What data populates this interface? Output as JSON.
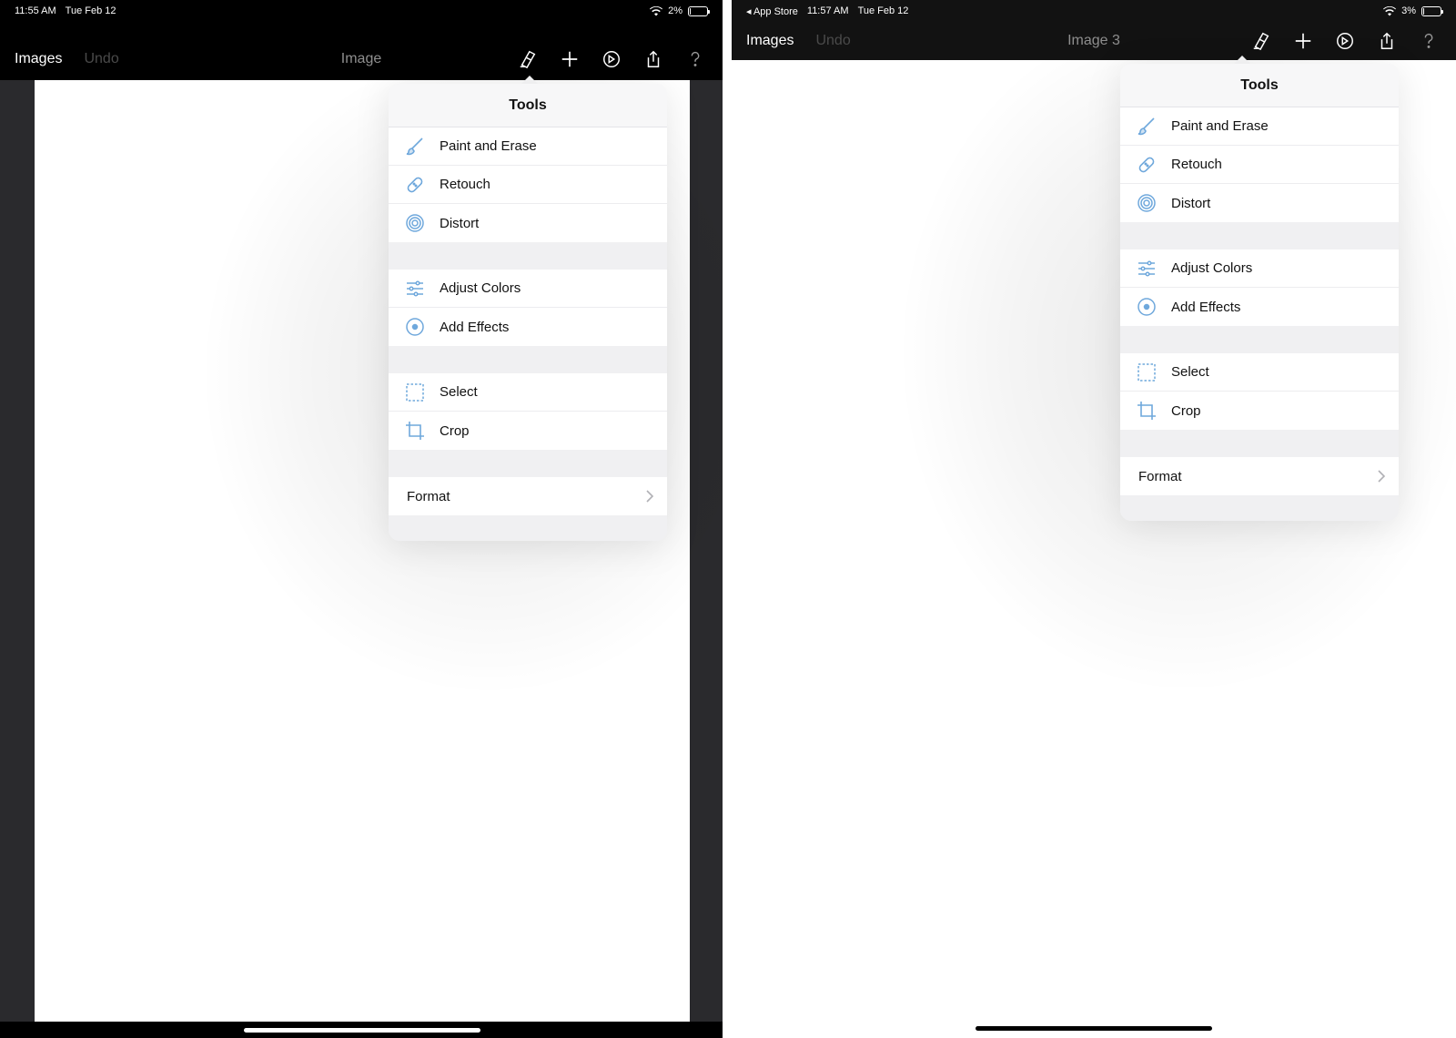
{
  "colors": {
    "accent": "#6fa8dc",
    "nav_bg": "#000000",
    "popover_bg": "#f2f2f4"
  },
  "left": {
    "status": {
      "time": "11:55 AM",
      "date": "Tue Feb 12",
      "battery": "2%",
      "battery_level": 0.02
    },
    "nav": {
      "images": "Images",
      "undo": "Undo",
      "title": "Image"
    }
  },
  "right": {
    "status": {
      "back": "◂ App Store",
      "time": "11:57 AM",
      "date": "Tue Feb 12",
      "battery": "3%",
      "battery_level": 0.03
    },
    "nav": {
      "images": "Images",
      "undo": "Undo",
      "title": "Image 3"
    }
  },
  "toolbar_icons": [
    "tools-icon",
    "plus-icon",
    "adjust-icon",
    "share-icon",
    "help-icon"
  ],
  "menu": {
    "title": "Tools",
    "groups": [
      [
        {
          "label": "Paint and Erase",
          "icon": "brush-icon"
        },
        {
          "label": "Retouch",
          "icon": "bandage-icon"
        },
        {
          "label": "Distort",
          "icon": "spiral-icon"
        }
      ],
      [
        {
          "label": "Adjust Colors",
          "icon": "sliders-icon"
        },
        {
          "label": "Add Effects",
          "icon": "effects-icon"
        }
      ],
      [
        {
          "label": "Select",
          "icon": "selection-icon"
        },
        {
          "label": "Crop",
          "icon": "crop-icon"
        }
      ],
      [
        {
          "label": "Format",
          "icon": "chevron-right-icon"
        }
      ]
    ]
  }
}
